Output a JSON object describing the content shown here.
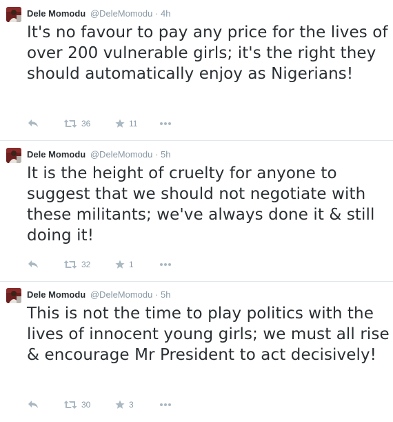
{
  "colors": {
    "text": "#292f33",
    "meta": "#8899a6",
    "icon": "#aab8c2",
    "divider": "#e1e8ed"
  },
  "tweets": [
    {
      "fullname": "Dele Momodu",
      "username": "@DeleMomodu",
      "separator": "·",
      "time": "4h",
      "text": "It's no favour to pay any price for the lives of over 200 vulnerable girls; it's the right they should automatically enjoy as Nigerians!",
      "retweets": "36",
      "favorites": "11",
      "icons": [
        "reply-icon",
        "retweet-icon",
        "favorite-icon",
        "more-icon"
      ]
    },
    {
      "fullname": "Dele Momodu",
      "username": "@DeleMomodu",
      "separator": "·",
      "time": "5h",
      "text": "It is the height of cruelty for anyone to suggest that we should not negotiate with these militants; we've always done it & still doing it!",
      "retweets": "32",
      "favorites": "1",
      "icons": [
        "reply-icon",
        "retweet-icon",
        "favorite-icon",
        "more-icon"
      ]
    },
    {
      "fullname": "Dele Momodu",
      "username": "@DeleMomodu",
      "separator": "·",
      "time": "5h",
      "text": "This is not the time to play politics with the lives of innocent young girls; we must all rise & encourage Mr President to act decisively!",
      "retweets": "30",
      "favorites": "3",
      "icons": [
        "reply-icon",
        "retweet-icon",
        "favorite-icon",
        "more-icon"
      ]
    }
  ]
}
